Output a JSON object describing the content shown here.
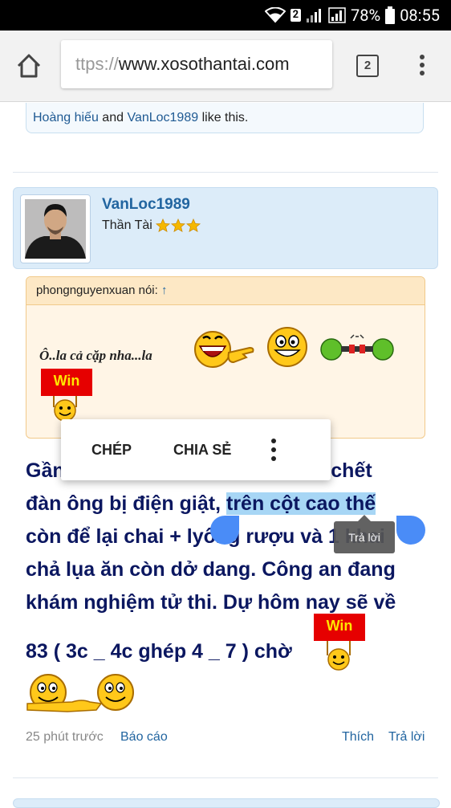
{
  "statusbar": {
    "sim_badge": "2",
    "battery": "78%",
    "time": "08:55"
  },
  "browser": {
    "url_scheme": "ttps://",
    "url_host": "www.xosothantai.com",
    "tab_count": "2"
  },
  "likes": {
    "user1": "Hoàng hiếu",
    "connector": "and",
    "user2": "VanLoc1989",
    "suffix": "like this."
  },
  "post": {
    "username": "VanLoc1989",
    "user_title": "Thần Tài",
    "stars": 3,
    "quote": {
      "author_label": "phongnguyenxuan nói:",
      "arrow": "↑",
      "text": "Ô..la cả cặp nha...la",
      "win_label": "Win"
    },
    "text_lines": [
      "Gần",
      "xác chết",
      "đàn ông bị điện giật,",
      "trên cột cao thế",
      "còn để lại chai + ly",
      "ống rượu và 1 khai",
      "chả lụa ăn còn dở dang. Công an đang",
      "khám nghiệm tử thi. Dự hôm nay sẽ về"
    ],
    "answer": "83 ( 3c _ 4c ghép 4 _ 7 ) chờ",
    "win_label": "Win",
    "time_ago": "25 phút trước",
    "report": "Báo cáo",
    "like": "Thích",
    "reply": "Trả lời"
  },
  "context_menu": {
    "copy": "CHÉP",
    "share": "CHIA SẺ"
  },
  "tooltip": "Trả lời",
  "icons": [
    "wifi-icon",
    "signal-icon",
    "battery-icon",
    "home-icon",
    "more-vert-icon",
    "star-icon",
    "smiley-icon"
  ],
  "colors": {
    "link": "#2265a0",
    "post_text": "#0b1760",
    "highlight": "#a7d6f5",
    "handle": "#4a8cf7"
  }
}
